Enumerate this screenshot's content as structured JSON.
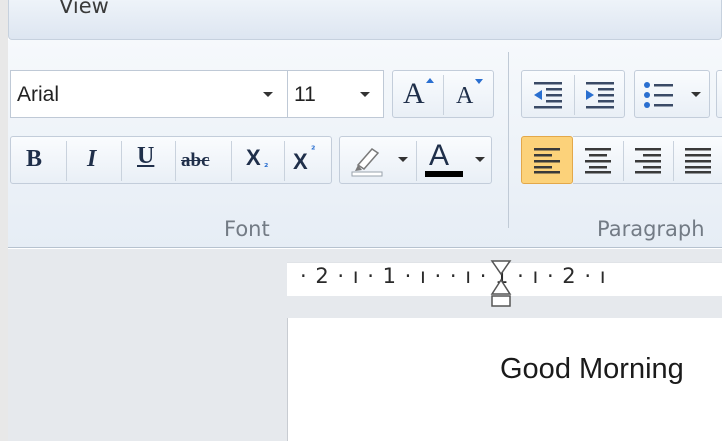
{
  "tabs": {
    "view": "View"
  },
  "font_group": {
    "label": "Font",
    "font_name": "Arial",
    "font_size": "11",
    "grow_label": "A",
    "shrink_label": "A",
    "bold_label": "B",
    "italic_label": "I",
    "underline_label": "U",
    "strike_label": "abc",
    "subscript_label": "X",
    "superscript_label": "X",
    "font_color_label": "A"
  },
  "paragraph_group": {
    "label": "Paragraph"
  },
  "ruler": {
    "text": "· 2 · ı · 1 · ı ·    · ı · 1 · ı · 2 · ı"
  },
  "document": {
    "text": "Good Morning"
  },
  "colors": {
    "highlight": "#ffff00",
    "font_color": "#000000",
    "active_button": "#fcd27a"
  }
}
